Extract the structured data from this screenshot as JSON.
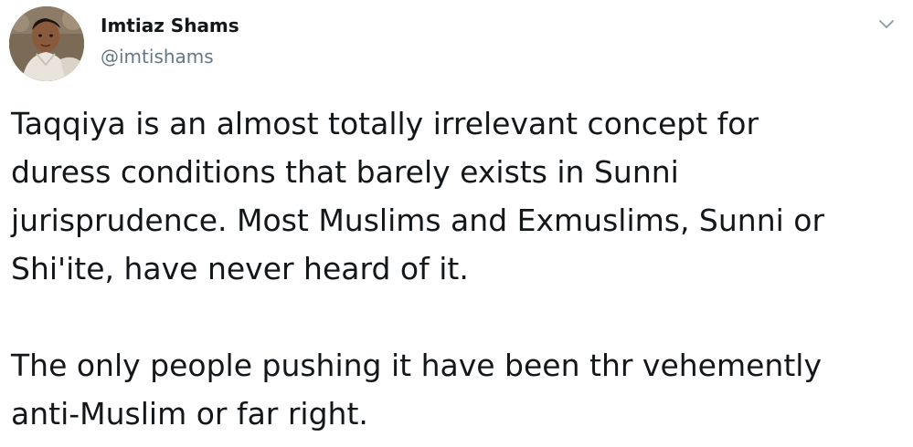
{
  "tweet": {
    "author": {
      "display_name": "Imtiaz Shams",
      "handle": "@imtishams",
      "avatar_icon": "profile-photo"
    },
    "menu_icon": "chevron-down-icon",
    "text_lines": [
      "Taqqiya is an almost totally irrelevant concept for",
      "duress conditions that barely exists in Sunni",
      "jurisprudence. Most Muslims and Exmuslims, Sunni or",
      "Shi'ite, have never heard of it.",
      "",
      "The only people pushing it have been thr vehemently",
      "anti-Muslim or far right."
    ],
    "colors": {
      "text": "#14171a",
      "secondary": "#657786",
      "caret": "#8899a6"
    }
  }
}
